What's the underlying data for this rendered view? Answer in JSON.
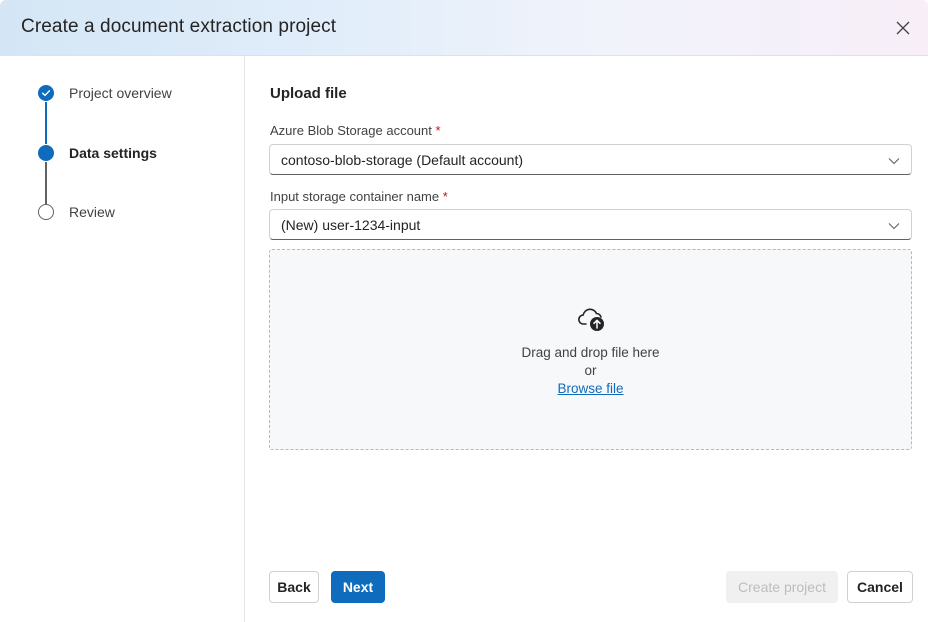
{
  "dialog": {
    "title": "Create a document extraction project",
    "close_icon": "close-icon"
  },
  "steps": [
    {
      "label": "Project overview",
      "state": "completed",
      "icon": "checkmark-circle-icon"
    },
    {
      "label": "Data settings",
      "state": "current",
      "icon": "filled-circle-icon"
    },
    {
      "label": "Review",
      "state": "upcoming",
      "icon": "empty-circle-icon"
    }
  ],
  "main": {
    "section_title": "Upload file",
    "fields": [
      {
        "label": "Azure Blob Storage account",
        "required_marker": "*",
        "value": "contoso-blob-storage (Default account)"
      },
      {
        "label": "Input storage container name",
        "required_marker": "*",
        "value": "(New) user-1234-input"
      }
    ],
    "dropzone": {
      "icon": "cloud-upload-icon",
      "instruction": "Drag and drop file here",
      "or": "or",
      "browse_link": "Browse file"
    }
  },
  "footer": {
    "back_label": "Back",
    "next_label": "Next",
    "create_label": "Create project",
    "cancel_label": "Cancel"
  },
  "colors": {
    "accent": "#0f6cbd",
    "required": "#c50f1f"
  }
}
